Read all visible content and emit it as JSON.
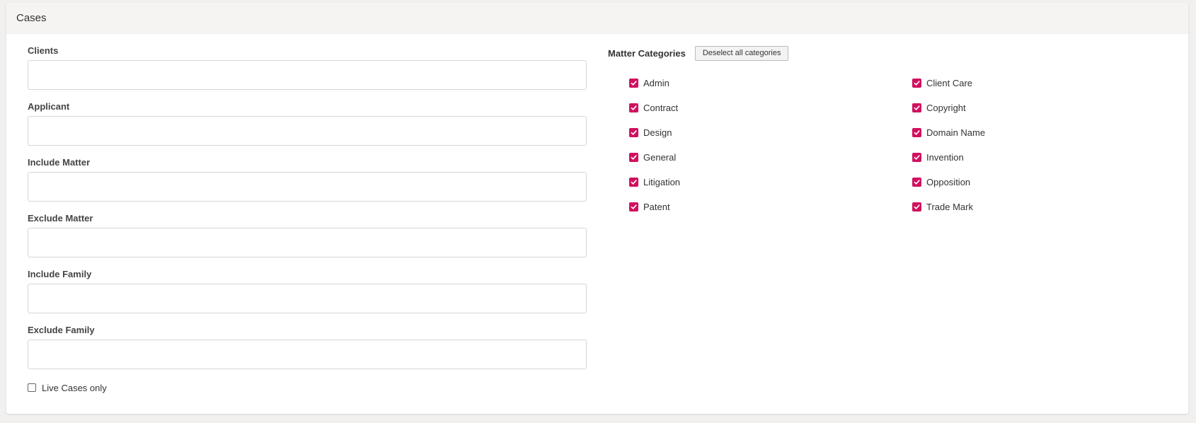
{
  "panel": {
    "title": "Cases"
  },
  "fields": [
    {
      "label": "Clients",
      "value": "",
      "placeholder": ""
    },
    {
      "label": "Applicant",
      "value": "",
      "placeholder": ""
    },
    {
      "label": "Include Matter",
      "value": "",
      "placeholder": ""
    },
    {
      "label": "Exclude Matter",
      "value": "",
      "placeholder": ""
    },
    {
      "label": "Include Family",
      "value": "",
      "placeholder": ""
    },
    {
      "label": "Exclude Family",
      "value": "",
      "placeholder": ""
    }
  ],
  "live_cases": {
    "label": "Live Cases only",
    "checked": false
  },
  "categories": {
    "title": "Matter Categories",
    "deselect_label": "Deselect all categories",
    "check_color": "#d0115f",
    "items": [
      {
        "label": "Admin",
        "checked": true
      },
      {
        "label": "Client Care",
        "checked": true
      },
      {
        "label": "Contract",
        "checked": true
      },
      {
        "label": "Copyright",
        "checked": true
      },
      {
        "label": "Design",
        "checked": true
      },
      {
        "label": "Domain Name",
        "checked": true
      },
      {
        "label": "General",
        "checked": true
      },
      {
        "label": "Invention",
        "checked": true
      },
      {
        "label": "Litigation",
        "checked": true
      },
      {
        "label": "Opposition",
        "checked": true
      },
      {
        "label": "Patent",
        "checked": true
      },
      {
        "label": "Trade Mark",
        "checked": true
      }
    ]
  }
}
